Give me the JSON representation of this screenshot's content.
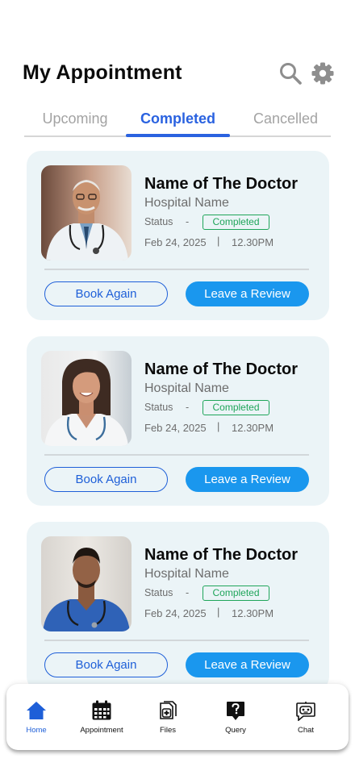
{
  "header": {
    "title": "My Appointment",
    "search_icon": "search-icon",
    "settings_icon": "gear-icon"
  },
  "tabs": [
    {
      "label": "Upcoming",
      "active": false
    },
    {
      "label": "Completed",
      "active": true
    },
    {
      "label": "Cancelled",
      "active": false
    }
  ],
  "colors": {
    "accent": "#2a62e0",
    "review_button": "#1a97ee",
    "status_green": "#1fa55a",
    "card_bg": "#ebf4f7"
  },
  "appointments": [
    {
      "doctor_name": "Name of The Doctor",
      "hospital": "Hospital Name",
      "status_label": "Status",
      "status_sep": "-",
      "status": "Completed",
      "date": "Feb 24, 2025",
      "time_sep": "|",
      "time": "12.30PM",
      "book_again_label": "Book Again",
      "review_label": "Leave a Review"
    },
    {
      "doctor_name": "Name of The Doctor",
      "hospital": "Hospital Name",
      "status_label": "Status",
      "status_sep": "-",
      "status": "Completed",
      "date": "Feb 24, 2025",
      "time_sep": "|",
      "time": "12.30PM",
      "book_again_label": "Book Again",
      "review_label": "Leave a Review"
    },
    {
      "doctor_name": "Name of The Doctor",
      "hospital": "Hospital Name",
      "status_label": "Status",
      "status_sep": "-",
      "status": "Completed",
      "date": "Feb 24, 2025",
      "time_sep": "|",
      "time": "12.30PM",
      "book_again_label": "Book Again",
      "review_label": "Leave a Review"
    }
  ],
  "nav": [
    {
      "label": "Home",
      "icon": "home-icon",
      "active": true
    },
    {
      "label": "Appointment",
      "icon": "calendar-icon",
      "active": false
    },
    {
      "label": "Files",
      "icon": "medical-files-icon",
      "active": false
    },
    {
      "label": "Query",
      "icon": "question-icon",
      "active": false
    },
    {
      "label": "Chat",
      "icon": "chatbot-icon",
      "active": false
    }
  ]
}
